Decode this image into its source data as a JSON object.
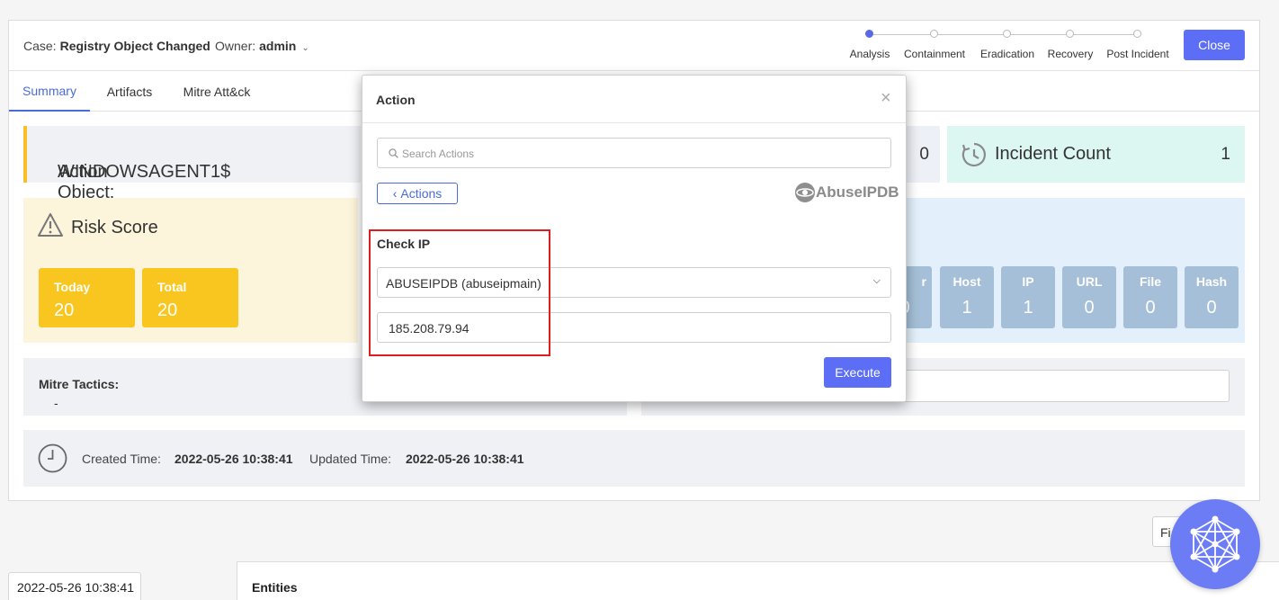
{
  "header": {
    "case_label": "Case:",
    "case_name": "Registry Object Changed",
    "owner_label": "Owner:",
    "owner_name": "admin",
    "steps": [
      "Analysis",
      "Containment",
      "Eradication",
      "Recovery",
      "Post Incident"
    ],
    "active_step": "Analysis",
    "close_label": "Close"
  },
  "tabs": [
    "Summary",
    "Artifacts",
    "Mitre Att&ck"
  ],
  "active_tab": "Summary",
  "action_object": {
    "label": "Action Object:",
    "value": "WINDOWSAGENT1$"
  },
  "partial_count": "0",
  "incident_count": {
    "label": "Incident Count",
    "value": "1"
  },
  "risk": {
    "title": "Risk Score",
    "today_label": "Today",
    "today_value": "20",
    "total_label": "Total",
    "total_value": "20"
  },
  "artifact_boxes": [
    {
      "label": "r",
      "value": "0"
    },
    {
      "label": "Host",
      "value": "1"
    },
    {
      "label": "IP",
      "value": "1"
    },
    {
      "label": "URL",
      "value": "0"
    },
    {
      "label": "File",
      "value": "0"
    },
    {
      "label": "Hash",
      "value": "0"
    }
  ],
  "mitre": {
    "label": "Mitre Tactics:",
    "value": "-"
  },
  "times": {
    "created_label": "Created Time:",
    "created_value": "2022-05-26 10:38:41",
    "updated_label": "Updated Time:",
    "updated_value": "2022-05-26 10:38:41"
  },
  "timeline_date": "2022-05-26 10:38:41",
  "entities_label": "Entities",
  "filter_partial": "Fi",
  "modal": {
    "title": "Action",
    "close_glyph": "×",
    "search_placeholder": "Search Actions",
    "back_label": "Actions",
    "brand": "AbuseIPDB",
    "section_title": "Check IP",
    "integration_value": "ABUSEIPDB (abuseipmain)",
    "ip_value": "185.208.79.94",
    "execute_label": "Execute"
  },
  "colors": {
    "accent": "#5b6ef5",
    "risk_yellow": "#f9c620",
    "artifact_blue": "#a4bfd7",
    "highlight_red": "#e01e1e"
  }
}
